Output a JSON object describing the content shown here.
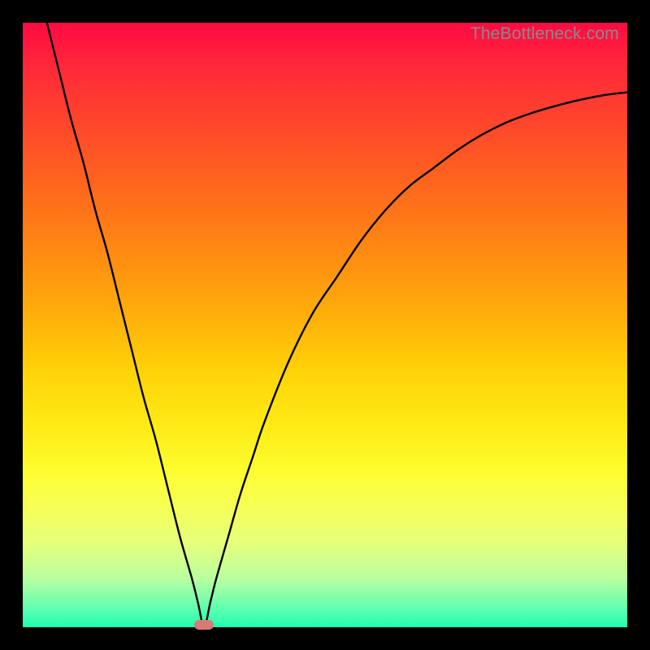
{
  "watermark": "TheBottleneck.com",
  "chart_data": {
    "type": "line",
    "title": "",
    "xlabel": "",
    "ylabel": "",
    "xlim": [
      0,
      100
    ],
    "ylim": [
      0,
      100
    ],
    "grid": false,
    "legend": false,
    "min_marker": {
      "x": 30,
      "y": 0
    },
    "series": [
      {
        "name": "curve",
        "x": [
          4,
          6,
          8,
          10,
          12,
          14,
          16,
          18,
          20,
          22,
          24,
          26,
          28,
          29,
          30,
          31,
          32,
          34,
          36,
          38,
          40,
          44,
          48,
          52,
          56,
          60,
          64,
          68,
          72,
          76,
          80,
          84,
          88,
          92,
          96,
          100
        ],
        "y": [
          100,
          92,
          84,
          77,
          69,
          62,
          54,
          46,
          38,
          31,
          23,
          15,
          8,
          4,
          0,
          4,
          8,
          15,
          22,
          28,
          34,
          44,
          52,
          58,
          64,
          69,
          73,
          76,
          79,
          81.5,
          83.5,
          85,
          86.2,
          87.2,
          88,
          88.5
        ]
      }
    ],
    "background_gradient": {
      "top": "#ff0a44",
      "bottom": "#1fffad"
    }
  }
}
